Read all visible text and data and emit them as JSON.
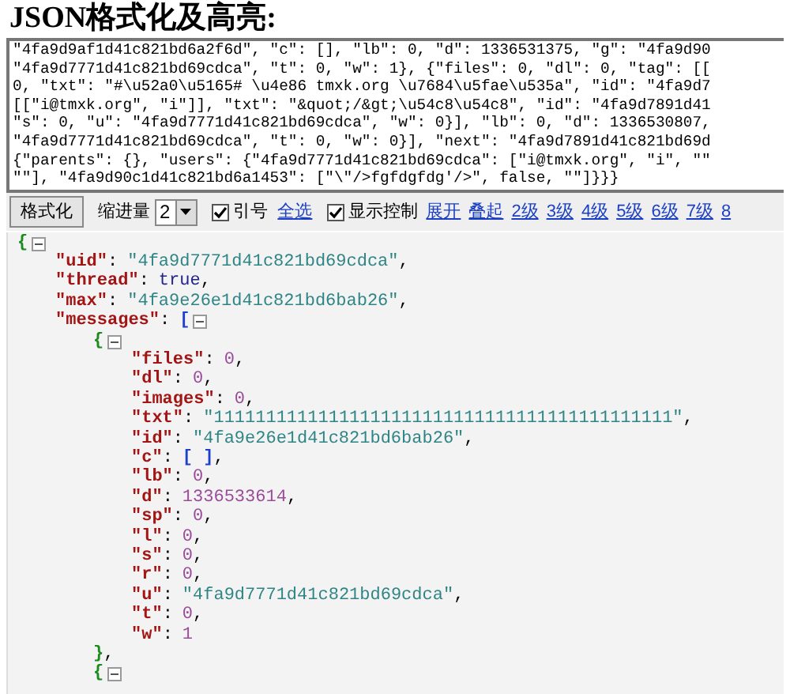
{
  "title": "JSON格式化及高亮:",
  "input": {
    "value": "\"4fa9d9af1d41c821bd6a2f6d\", \"c\": [], \"lb\": 0, \"d\": 1336531375, \"g\": \"4fa9d90\n\"4fa9d7771d41c821bd69cdca\", \"t\": 0, \"w\": 1}, {\"files\": 0, \"dl\": 0, \"tag\": [[\n0, \"txt\": \"#\\u52a0\\u5165# \\u4e86 tmxk.org \\u7684\\u5fae\\u535a\", \"id\": \"4fa9d7\n[[\"i@tmxk.org\", \"i\"]], \"txt\": \"&quot;/&gt;\\u54c8\\u54c8\", \"id\": \"4fa9d7891d41\n\"s\": 0, \"u\": \"4fa9d7771d41c821bd69cdca\", \"w\": 0}], \"lb\": 0, \"d\": 1336530807,\n\"4fa9d7771d41c821bd69cdca\", \"t\": 0, \"w\": 0}], \"next\": \"4fa9d7891d41c821bd69d\n{\"parents\": {}, \"users\": {\"4fa9d7771d41c821bd69cdca\": [\"i@tmxk.org\", \"i\", \"\"\n\"\"], \"4fa9d90c1d41c821bd6a1453\": [\"\\\"/>fgfdgfdg'/>\", false, \"\"]}}}"
  },
  "toolbar": {
    "format_button": "格式化",
    "indent_label": "缩进量",
    "indent_value": "2",
    "options": [
      {
        "label": "引号",
        "checked": true,
        "link": "全选"
      },
      {
        "label": "显示控制",
        "checked": true
      }
    ],
    "level_links": [
      "展开",
      "叠起",
      "2级",
      "3级",
      "4级",
      "5级",
      "6级",
      "7级",
      "8"
    ]
  },
  "output": {
    "kind": "object",
    "open": "{",
    "expanded": true,
    "children": [
      {
        "key": "\"uid\"",
        "colon": ":",
        "kind": "string",
        "value": "\"4fa9d7771d41c821bd69cdca\"",
        "comma": ","
      },
      {
        "key": "\"thread\"",
        "colon": ":",
        "kind": "bool",
        "value": "true",
        "comma": ","
      },
      {
        "key": "\"max\"",
        "colon": ":",
        "kind": "string",
        "value": "\"4fa9e26e1d41c821bd6bab26\"",
        "comma": ","
      },
      {
        "key": "\"messages\"",
        "colon": ":",
        "kind": "array",
        "open": "[",
        "expanded": true,
        "children": [
          {
            "kind": "object",
            "open": "{",
            "expanded": true,
            "close": "}",
            "comma": ",",
            "children": [
              {
                "key": "\"files\"",
                "colon": ":",
                "kind": "number",
                "value": "0",
                "comma": ","
              },
              {
                "key": "\"dl\"",
                "colon": ":",
                "kind": "number",
                "value": "0",
                "comma": ","
              },
              {
                "key": "\"images\"",
                "colon": ":",
                "kind": "number",
                "value": "0",
                "comma": ","
              },
              {
                "key": "\"txt\"",
                "colon": ":",
                "kind": "string",
                "value": "\"11111111111111111111111111111111111111111111\"",
                "comma": ","
              },
              {
                "key": "\"id\"",
                "colon": ":",
                "kind": "string",
                "value": "\"4fa9e26e1d41c821bd6bab26\"",
                "comma": ","
              },
              {
                "key": "\"c\"",
                "colon": ":",
                "kind": "empty_array",
                "value": "[ ]",
                "comma": ","
              },
              {
                "key": "\"lb\"",
                "colon": ":",
                "kind": "number",
                "value": "0",
                "comma": ","
              },
              {
                "key": "\"d\"",
                "colon": ":",
                "kind": "number",
                "value": "1336533614",
                "comma": ","
              },
              {
                "key": "\"sp\"",
                "colon": ":",
                "kind": "number",
                "value": "0",
                "comma": ","
              },
              {
                "key": "\"l\"",
                "colon": ":",
                "kind": "number",
                "value": "0",
                "comma": ","
              },
              {
                "key": "\"s\"",
                "colon": ":",
                "kind": "number",
                "value": "0",
                "comma": ","
              },
              {
                "key": "\"r\"",
                "colon": ":",
                "kind": "number",
                "value": "0",
                "comma": ","
              },
              {
                "key": "\"u\"",
                "colon": ":",
                "kind": "string",
                "value": "\"4fa9d7771d41c821bd69cdca\"",
                "comma": ","
              },
              {
                "key": "\"t\"",
                "colon": ":",
                "kind": "number",
                "value": "0",
                "comma": ","
              },
              {
                "key": "\"w\"",
                "colon": ":",
                "kind": "number",
                "value": "1"
              }
            ]
          },
          {
            "kind": "object",
            "open": "{",
            "expanded": true
          }
        ]
      }
    ]
  }
}
